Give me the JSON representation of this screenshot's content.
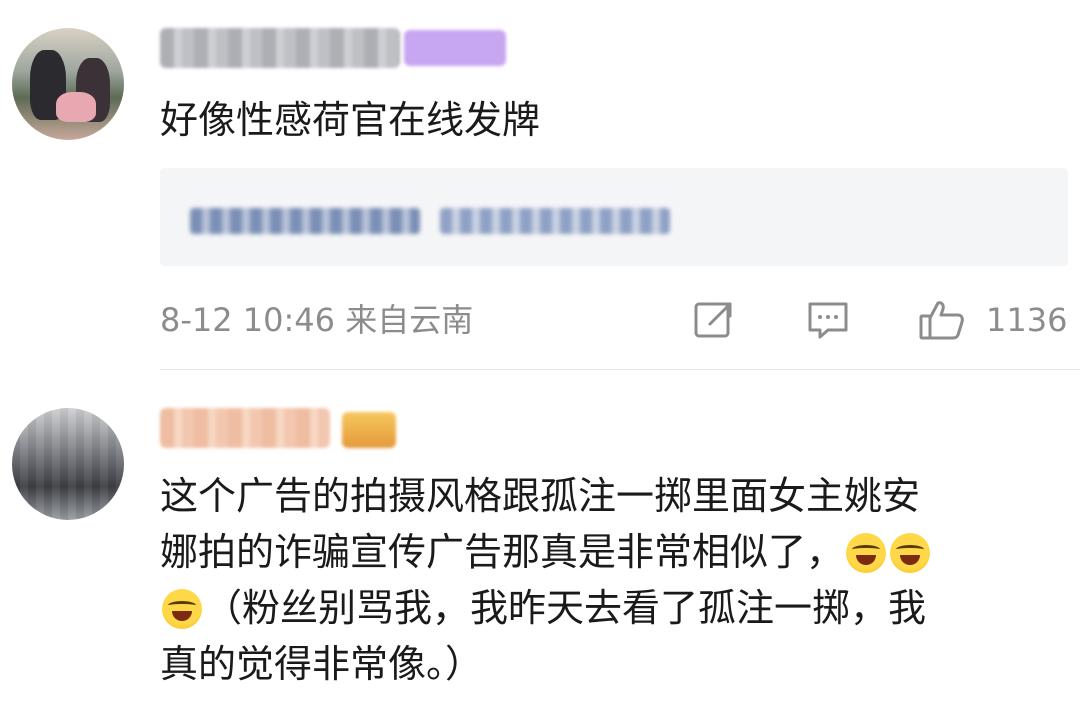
{
  "comments": [
    {
      "text": "好像性感荷官在线发牌",
      "meta": "8-12 10:46 来自云南",
      "likes": "1136"
    },
    {
      "text_line1": "这个广告的拍摄风格跟孤注一掷里面女主姚安",
      "text_line2": "娜拍的诈骗宣传广告那真是非常相似了，",
      "text_line3": "（粉丝别骂我，我昨天去看了孤注一掷，我",
      "text_line4": "真的觉得非常像。）"
    }
  ],
  "icons": [
    "share-icon",
    "comment-icon",
    "like-icon",
    "laughing-crying-emoji"
  ],
  "colors": {
    "text": "#1a1a1a",
    "meta": "#8c8c8c",
    "reply_bg": "#f4f5f7",
    "icon": "#8c8c8c"
  }
}
